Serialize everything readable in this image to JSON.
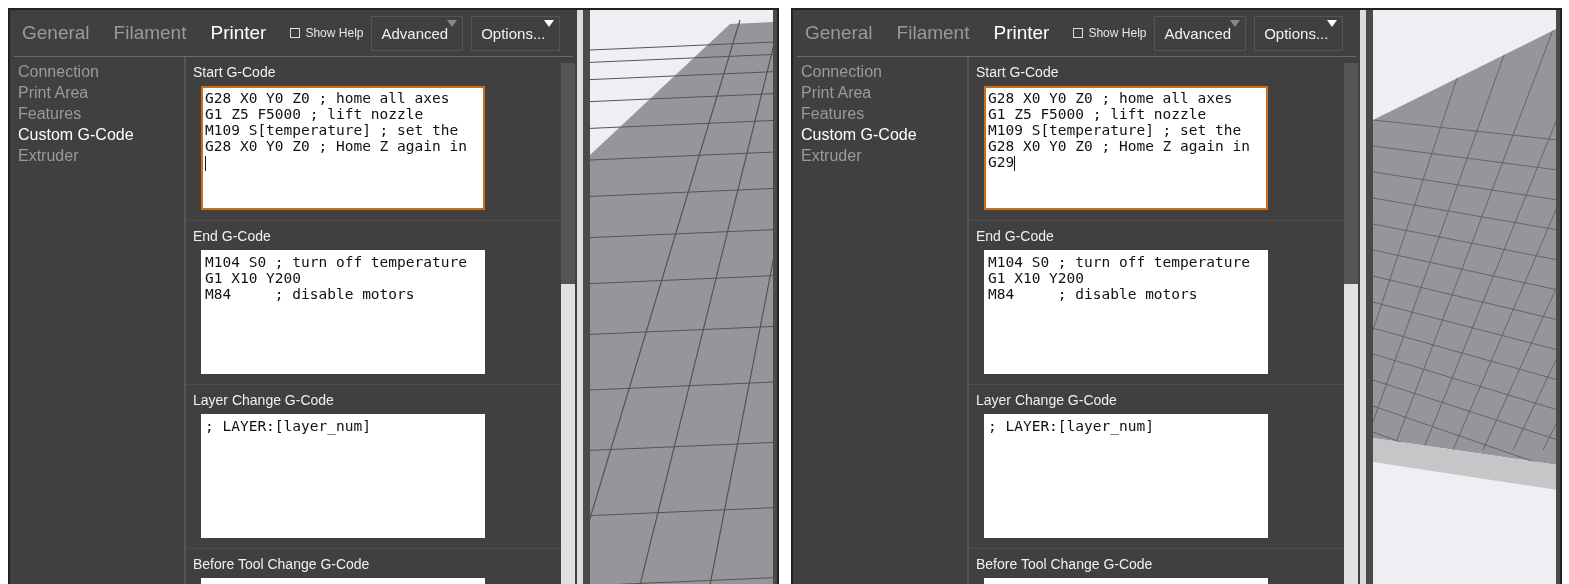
{
  "panels": [
    {
      "tabs": [
        {
          "label": "General",
          "selected": false
        },
        {
          "label": "Filament",
          "selected": false
        },
        {
          "label": "Printer",
          "selected": true
        }
      ],
      "show_help": {
        "label": "Show Help",
        "checked": false
      },
      "mode_button": {
        "label": "Advanced"
      },
      "options_button": {
        "label": "Options..."
      },
      "sidebar": {
        "items": [
          {
            "label": "Connection",
            "selected": false
          },
          {
            "label": "Print Area",
            "selected": false
          },
          {
            "label": "Features",
            "selected": false
          },
          {
            "label": "Custom G-Code",
            "selected": true
          },
          {
            "label": "Extruder",
            "selected": false
          }
        ]
      },
      "sections": [
        {
          "label": "Start G-Code",
          "focused": true,
          "caret": true,
          "trailing_newline": true,
          "lines": [
            "G28 X0 Y0 Z0 ; home all axes",
            "G1 Z5 F5000 ; lift nozzle",
            "M109 S[temperature] ; set the",
            "G28 X0 Y0 Z0 ; Home Z again in"
          ]
        },
        {
          "label": "End G-Code",
          "focused": false,
          "caret": false,
          "lines": [
            "M104 S0 ; turn off temperature",
            "G1 X10 Y200",
            "M84     ; disable motors"
          ]
        },
        {
          "label": "Layer Change G-Code",
          "focused": false,
          "caret": false,
          "lines": [
            "; LAYER:[layer_num]"
          ]
        },
        {
          "label": "Before Tool Change G-Code",
          "focused": false
        }
      ],
      "viewport": {
        "kind": "steep"
      }
    },
    {
      "tabs": [
        {
          "label": "General",
          "selected": false
        },
        {
          "label": "Filament",
          "selected": false
        },
        {
          "label": "Printer",
          "selected": true
        }
      ],
      "show_help": {
        "label": "Show Help",
        "checked": false
      },
      "mode_button": {
        "label": "Advanced"
      },
      "options_button": {
        "label": "Options..."
      },
      "sidebar": {
        "items": [
          {
            "label": "Connection",
            "selected": false
          },
          {
            "label": "Print Area",
            "selected": false
          },
          {
            "label": "Features",
            "selected": false
          },
          {
            "label": "Custom G-Code",
            "selected": true
          },
          {
            "label": "Extruder",
            "selected": false
          }
        ]
      },
      "sections": [
        {
          "label": "Start G-Code",
          "focused": true,
          "caret": true,
          "trailing_newline": false,
          "lines": [
            "G28 X0 Y0 Z0 ; home all axes",
            "G1 Z5 F5000 ; lift nozzle",
            "M109 S[temperature] ; set the",
            "G28 X0 Y0 Z0 ; Home Z again in",
            "G29"
          ]
        },
        {
          "label": "End G-Code",
          "focused": false,
          "caret": false,
          "lines": [
            "M104 S0 ; turn off temperature",
            "G1 X10 Y200",
            "M84     ; disable motors"
          ]
        },
        {
          "label": "Layer Change G-Code",
          "focused": false,
          "caret": false,
          "lines": [
            "; LAYER:[layer_num]"
          ]
        },
        {
          "label": "Before Tool Change G-Code",
          "focused": false
        }
      ],
      "viewport": {
        "kind": "flat"
      }
    }
  ]
}
